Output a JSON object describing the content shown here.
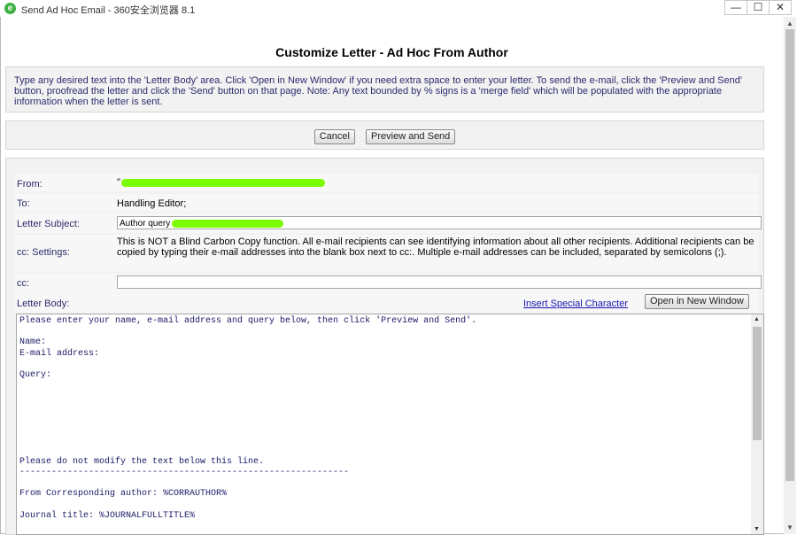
{
  "window": {
    "title": "Send Ad Hoc Email - 360安全浏览器 8.1",
    "minimize": "—",
    "maximize": "☐",
    "close": "✕"
  },
  "page": {
    "heading": "Customize Letter - Ad Hoc From Author",
    "instructions": "Type any desired text into the 'Letter Body' area. Click 'Open in New Window' if you need extra space to enter your letter. To send the e-mail, click the 'Preview and Send' button, proofread the letter and click the 'Send' button on that page. Note: Any text bounded by % signs is a 'merge field' which will be populated with the appropriate information when the letter is sent."
  },
  "buttons": {
    "cancel": "Cancel",
    "preview_send": "Preview and Send",
    "open_new_window": "Open in New Window",
    "insert_special_char": "Insert Special Character"
  },
  "form": {
    "from_label": "From:",
    "from_value": "\"",
    "to_label": "To:",
    "to_value": "Handling Editor;",
    "subject_label": "Letter Subject:",
    "subject_value": "Author query",
    "cc_settings_label": "cc: Settings:",
    "cc_settings_text": "This is NOT a Blind Carbon Copy function. All e-mail recipients can see identifying information about all other recipients. Additional recipients can be copied by typing their e-mail addresses into the blank box next to cc:. Multiple e-mail addresses can be included, separated by semicolons (;).",
    "cc_label": "cc:",
    "cc_value": "",
    "body_label": "Letter Body:"
  },
  "letter_body": "Please enter your name, e-mail address and query below, then click 'Preview and Send'.\n\nName:\nE-mail address:\n\nQuery:\n\n\n\n\n\n\n\nPlease do not modify the text below this line.\n--------------------------------------------------------------\n\nFrom Corresponding author: %CORRAUTHOR%\n\nJournal title: %JOURNALFULLTITLE%",
  "colors": {
    "label": "#2b2b6e",
    "link": "#1a14b4",
    "redaction": "#7cfc00"
  }
}
